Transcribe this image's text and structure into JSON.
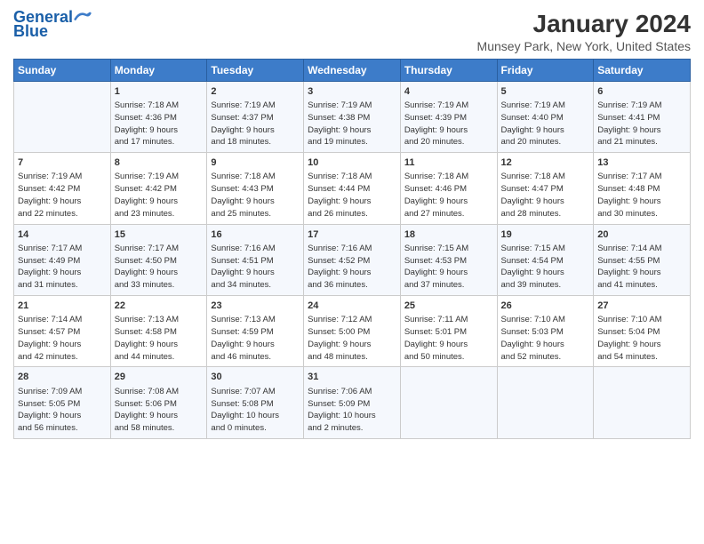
{
  "header": {
    "logo_line1": "General",
    "logo_line2": "Blue",
    "title": "January 2024",
    "subtitle": "Munsey Park, New York, United States"
  },
  "columns": [
    "Sunday",
    "Monday",
    "Tuesday",
    "Wednesday",
    "Thursday",
    "Friday",
    "Saturday"
  ],
  "weeks": [
    [
      {
        "day": "",
        "lines": []
      },
      {
        "day": "1",
        "lines": [
          "Sunrise: 7:18 AM",
          "Sunset: 4:36 PM",
          "Daylight: 9 hours",
          "and 17 minutes."
        ]
      },
      {
        "day": "2",
        "lines": [
          "Sunrise: 7:19 AM",
          "Sunset: 4:37 PM",
          "Daylight: 9 hours",
          "and 18 minutes."
        ]
      },
      {
        "day": "3",
        "lines": [
          "Sunrise: 7:19 AM",
          "Sunset: 4:38 PM",
          "Daylight: 9 hours",
          "and 19 minutes."
        ]
      },
      {
        "day": "4",
        "lines": [
          "Sunrise: 7:19 AM",
          "Sunset: 4:39 PM",
          "Daylight: 9 hours",
          "and 20 minutes."
        ]
      },
      {
        "day": "5",
        "lines": [
          "Sunrise: 7:19 AM",
          "Sunset: 4:40 PM",
          "Daylight: 9 hours",
          "and 20 minutes."
        ]
      },
      {
        "day": "6",
        "lines": [
          "Sunrise: 7:19 AM",
          "Sunset: 4:41 PM",
          "Daylight: 9 hours",
          "and 21 minutes."
        ]
      }
    ],
    [
      {
        "day": "7",
        "lines": [
          "Sunrise: 7:19 AM",
          "Sunset: 4:42 PM",
          "Daylight: 9 hours",
          "and 22 minutes."
        ]
      },
      {
        "day": "8",
        "lines": [
          "Sunrise: 7:19 AM",
          "Sunset: 4:42 PM",
          "Daylight: 9 hours",
          "and 23 minutes."
        ]
      },
      {
        "day": "9",
        "lines": [
          "Sunrise: 7:18 AM",
          "Sunset: 4:43 PM",
          "Daylight: 9 hours",
          "and 25 minutes."
        ]
      },
      {
        "day": "10",
        "lines": [
          "Sunrise: 7:18 AM",
          "Sunset: 4:44 PM",
          "Daylight: 9 hours",
          "and 26 minutes."
        ]
      },
      {
        "day": "11",
        "lines": [
          "Sunrise: 7:18 AM",
          "Sunset: 4:46 PM",
          "Daylight: 9 hours",
          "and 27 minutes."
        ]
      },
      {
        "day": "12",
        "lines": [
          "Sunrise: 7:18 AM",
          "Sunset: 4:47 PM",
          "Daylight: 9 hours",
          "and 28 minutes."
        ]
      },
      {
        "day": "13",
        "lines": [
          "Sunrise: 7:17 AM",
          "Sunset: 4:48 PM",
          "Daylight: 9 hours",
          "and 30 minutes."
        ]
      }
    ],
    [
      {
        "day": "14",
        "lines": [
          "Sunrise: 7:17 AM",
          "Sunset: 4:49 PM",
          "Daylight: 9 hours",
          "and 31 minutes."
        ]
      },
      {
        "day": "15",
        "lines": [
          "Sunrise: 7:17 AM",
          "Sunset: 4:50 PM",
          "Daylight: 9 hours",
          "and 33 minutes."
        ]
      },
      {
        "day": "16",
        "lines": [
          "Sunrise: 7:16 AM",
          "Sunset: 4:51 PM",
          "Daylight: 9 hours",
          "and 34 minutes."
        ]
      },
      {
        "day": "17",
        "lines": [
          "Sunrise: 7:16 AM",
          "Sunset: 4:52 PM",
          "Daylight: 9 hours",
          "and 36 minutes."
        ]
      },
      {
        "day": "18",
        "lines": [
          "Sunrise: 7:15 AM",
          "Sunset: 4:53 PM",
          "Daylight: 9 hours",
          "and 37 minutes."
        ]
      },
      {
        "day": "19",
        "lines": [
          "Sunrise: 7:15 AM",
          "Sunset: 4:54 PM",
          "Daylight: 9 hours",
          "and 39 minutes."
        ]
      },
      {
        "day": "20",
        "lines": [
          "Sunrise: 7:14 AM",
          "Sunset: 4:55 PM",
          "Daylight: 9 hours",
          "and 41 minutes."
        ]
      }
    ],
    [
      {
        "day": "21",
        "lines": [
          "Sunrise: 7:14 AM",
          "Sunset: 4:57 PM",
          "Daylight: 9 hours",
          "and 42 minutes."
        ]
      },
      {
        "day": "22",
        "lines": [
          "Sunrise: 7:13 AM",
          "Sunset: 4:58 PM",
          "Daylight: 9 hours",
          "and 44 minutes."
        ]
      },
      {
        "day": "23",
        "lines": [
          "Sunrise: 7:13 AM",
          "Sunset: 4:59 PM",
          "Daylight: 9 hours",
          "and 46 minutes."
        ]
      },
      {
        "day": "24",
        "lines": [
          "Sunrise: 7:12 AM",
          "Sunset: 5:00 PM",
          "Daylight: 9 hours",
          "and 48 minutes."
        ]
      },
      {
        "day": "25",
        "lines": [
          "Sunrise: 7:11 AM",
          "Sunset: 5:01 PM",
          "Daylight: 9 hours",
          "and 50 minutes."
        ]
      },
      {
        "day": "26",
        "lines": [
          "Sunrise: 7:10 AM",
          "Sunset: 5:03 PM",
          "Daylight: 9 hours",
          "and 52 minutes."
        ]
      },
      {
        "day": "27",
        "lines": [
          "Sunrise: 7:10 AM",
          "Sunset: 5:04 PM",
          "Daylight: 9 hours",
          "and 54 minutes."
        ]
      }
    ],
    [
      {
        "day": "28",
        "lines": [
          "Sunrise: 7:09 AM",
          "Sunset: 5:05 PM",
          "Daylight: 9 hours",
          "and 56 minutes."
        ]
      },
      {
        "day": "29",
        "lines": [
          "Sunrise: 7:08 AM",
          "Sunset: 5:06 PM",
          "Daylight: 9 hours",
          "and 58 minutes."
        ]
      },
      {
        "day": "30",
        "lines": [
          "Sunrise: 7:07 AM",
          "Sunset: 5:08 PM",
          "Daylight: 10 hours",
          "and 0 minutes."
        ]
      },
      {
        "day": "31",
        "lines": [
          "Sunrise: 7:06 AM",
          "Sunset: 5:09 PM",
          "Daylight: 10 hours",
          "and 2 minutes."
        ]
      },
      {
        "day": "",
        "lines": []
      },
      {
        "day": "",
        "lines": []
      },
      {
        "day": "",
        "lines": []
      }
    ]
  ]
}
